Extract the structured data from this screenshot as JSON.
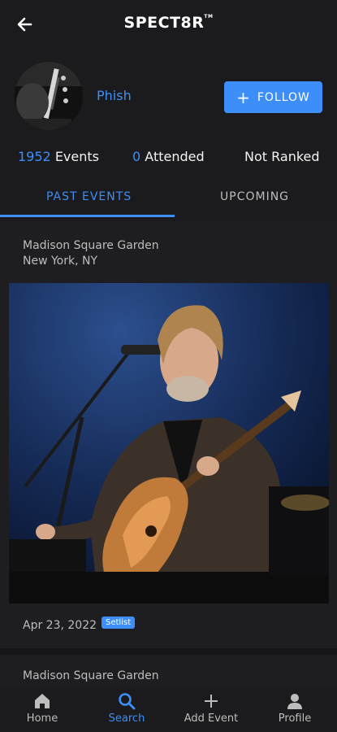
{
  "app": {
    "logo": "SPECT8R",
    "logo_tm": "TM"
  },
  "artist": {
    "name": "Phish"
  },
  "follow_label": "FOLLOW",
  "stats": {
    "events_count": "1952",
    "events_label": "Events",
    "attended_count": "0",
    "attended_label": "Attended",
    "rank_label": "Not Ranked"
  },
  "tabs": {
    "past": "PAST EVENTS",
    "upcoming": "UPCOMING"
  },
  "event": {
    "venue": "Madison Square Garden",
    "location": "New York, NY",
    "date": "Apr 23, 2022",
    "badge": "Setlist"
  },
  "next_event": {
    "venue": "Madison Square Garden"
  },
  "nav": {
    "home": "Home",
    "search": "Search",
    "add_event": "Add Event",
    "profile": "Profile"
  },
  "colors": {
    "accent": "#3d8ef8",
    "background": "#1e1e20",
    "bar": "#1b1b1d"
  },
  "icons": [
    "back-arrow-icon",
    "plus-icon",
    "home-icon",
    "search-icon",
    "add-icon",
    "profile-icon"
  ]
}
